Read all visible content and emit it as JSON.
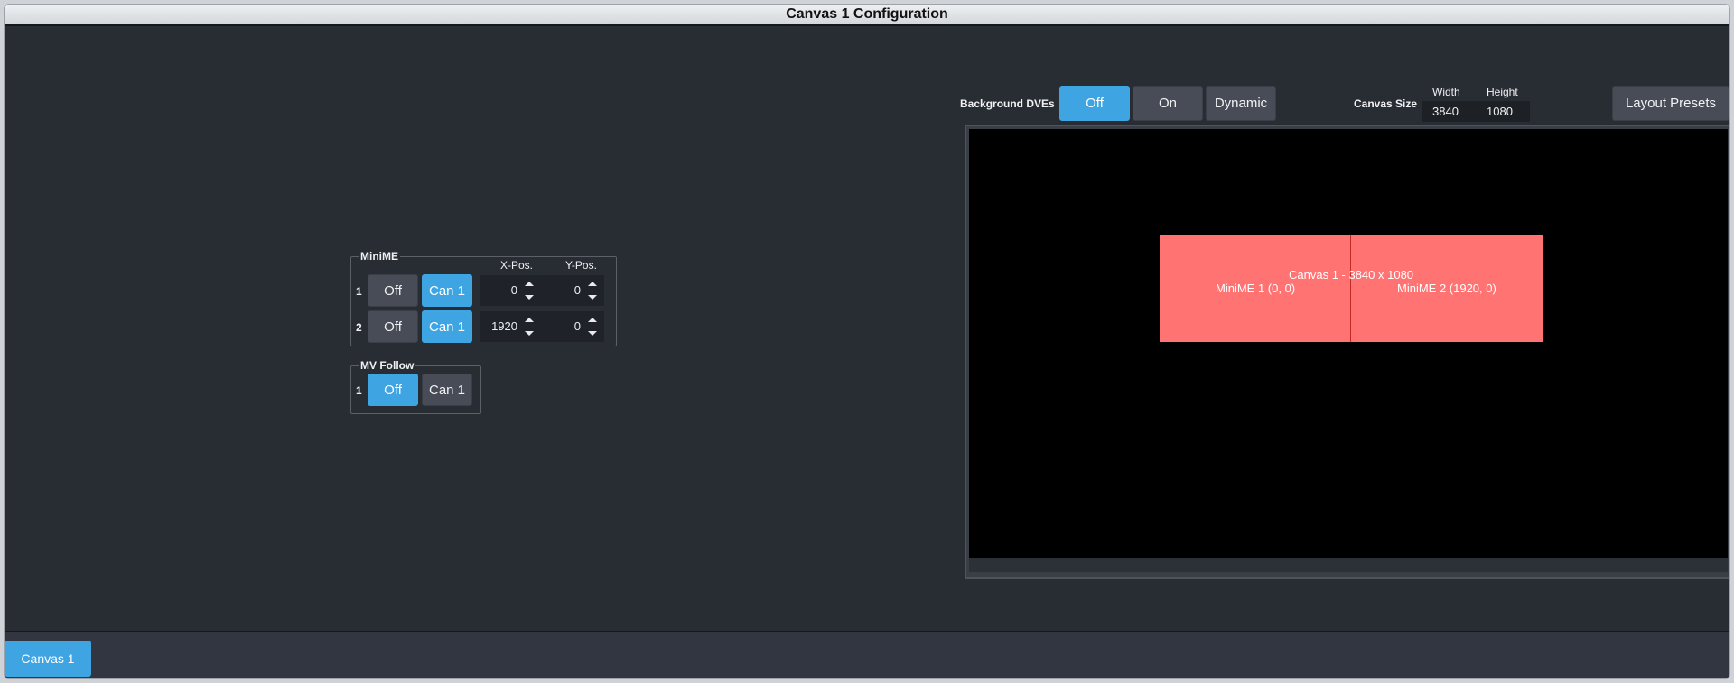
{
  "window": {
    "title": "Canvas 1 Configuration"
  },
  "minime": {
    "group_title": "MiniME",
    "x_header": "X-Pos.",
    "y_header": "Y-Pos.",
    "rows": [
      {
        "num": "1",
        "off_label": "Off",
        "can_label": "Can 1",
        "x": "0",
        "y": "0",
        "selected": "Can 1"
      },
      {
        "num": "2",
        "off_label": "Off",
        "can_label": "Can 1",
        "x": "1920",
        "y": "0",
        "selected": "Can 1"
      }
    ]
  },
  "mv_follow": {
    "group_title": "MV Follow",
    "rows": [
      {
        "num": "1",
        "off_label": "Off",
        "can_label": "Can 1",
        "selected": "Off"
      }
    ]
  },
  "background_dves": {
    "label": "Background DVEs",
    "options": [
      "Off",
      "On",
      "Dynamic"
    ],
    "selected": "Off"
  },
  "canvas_size": {
    "label": "Canvas Size",
    "width_label": "Width",
    "height_label": "Height",
    "width": "3840",
    "height": "1080"
  },
  "layout_presets_label": "Layout Presets",
  "preview": {
    "canvas_label": "Canvas 1 - 3840 x 1080",
    "minime1_label": "MiniME 1 (0, 0)",
    "minime2_label": "MiniME 2 (1920, 0)",
    "canvas_color": "#ff7373"
  },
  "bottom_tabs": [
    {
      "label": "Canvas 1",
      "active": true
    }
  ],
  "colors": {
    "accent": "#3ea4e2",
    "button": "#474c56",
    "background": "#282c33"
  }
}
